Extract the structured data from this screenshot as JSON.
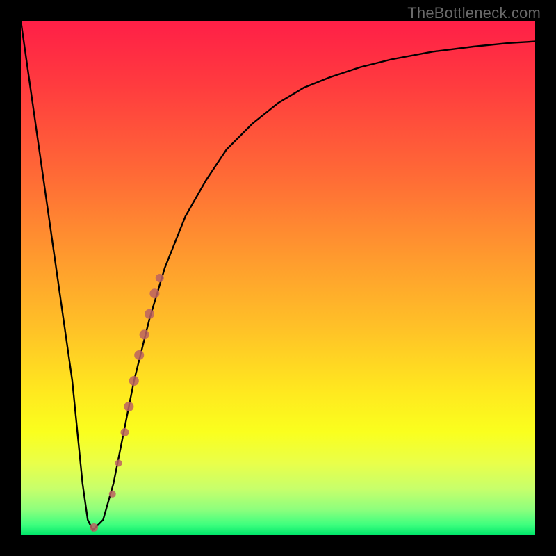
{
  "watermark": {
    "text": "TheBottleneck.com"
  },
  "chart_data": {
    "type": "line",
    "title": "",
    "xlabel": "",
    "ylabel": "",
    "xlim": [
      0,
      100
    ],
    "ylim": [
      0,
      100
    ],
    "grid": false,
    "legend": false,
    "series": [
      {
        "name": "curve",
        "x": [
          0,
          2,
          4,
          6,
          8,
          10,
          11,
          12,
          13,
          14,
          16,
          18,
          20,
          22,
          25,
          28,
          32,
          36,
          40,
          45,
          50,
          55,
          60,
          66,
          72,
          80,
          88,
          95,
          100
        ],
        "y": [
          100,
          86,
          72,
          58,
          44,
          30,
          20,
          10,
          3,
          1,
          3,
          10,
          20,
          30,
          42,
          52,
          62,
          69,
          75,
          80,
          84,
          87,
          89,
          91,
          92.5,
          94,
          95,
          95.7,
          96
        ]
      }
    ],
    "scatter_overlay": {
      "name": "highlight-dots",
      "color": "#bb6161",
      "points": [
        {
          "x": 14.2,
          "y": 1.5,
          "r": 6
        },
        {
          "x": 17.8,
          "y": 8,
          "r": 5
        },
        {
          "x": 19.0,
          "y": 14,
          "r": 5
        },
        {
          "x": 20.2,
          "y": 20,
          "r": 6
        },
        {
          "x": 21.0,
          "y": 25,
          "r": 7
        },
        {
          "x": 22.0,
          "y": 30,
          "r": 7
        },
        {
          "x": 23.0,
          "y": 35,
          "r": 7
        },
        {
          "x": 24.0,
          "y": 39,
          "r": 7
        },
        {
          "x": 25.0,
          "y": 43,
          "r": 7
        },
        {
          "x": 26.0,
          "y": 47,
          "r": 7
        },
        {
          "x": 27.0,
          "y": 50,
          "r": 6
        }
      ]
    },
    "background_gradient": {
      "orientation": "vertical",
      "stops": [
        {
          "pos": 0.0,
          "color": "#ff1f47"
        },
        {
          "pos": 0.3,
          "color": "#ff6a36"
        },
        {
          "pos": 0.6,
          "color": "#ffc227"
        },
        {
          "pos": 0.8,
          "color": "#faff1e"
        },
        {
          "pos": 0.95,
          "color": "#8eff7d"
        },
        {
          "pos": 1.0,
          "color": "#00e56a"
        }
      ]
    }
  }
}
